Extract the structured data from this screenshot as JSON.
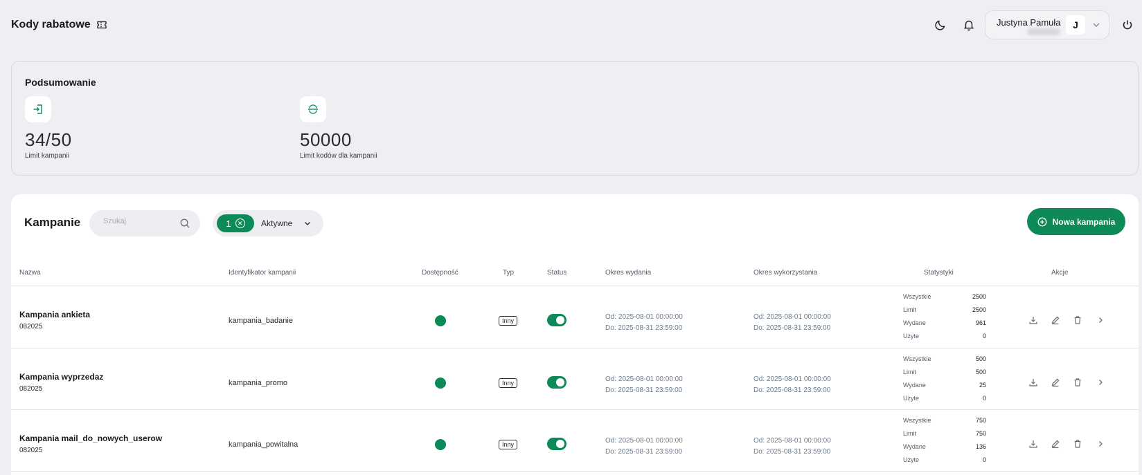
{
  "header": {
    "title": "Kody rabatowe",
    "user": {
      "name": "Justyna Pamuła",
      "avatar_letter": "J"
    }
  },
  "summary": {
    "title": "Podsumowanie",
    "stats": [
      {
        "value": "34/50",
        "label": "Limit kampanii",
        "icon": "login-arrow-icon"
      },
      {
        "value": "50000",
        "label": "Limit kodów dla kampanii",
        "icon": "code-limit-icon"
      }
    ]
  },
  "campaigns": {
    "title": "Kampanie",
    "search_placeholder": "Szukaj",
    "filter": {
      "count": "1",
      "label": "Aktywne"
    },
    "new_button": "Nowa kampania",
    "columns": [
      "Nazwa",
      "Identyfikator kampanii",
      "Dostępność",
      "Typ",
      "Status",
      "Okres wydania",
      "Okres wykorzystania",
      "Statystyki",
      "Akcje"
    ],
    "stat_keys": [
      "Wszystkie",
      "Limit",
      "Wydane",
      "Użyte"
    ],
    "rows": [
      {
        "name": "Kampania ankieta",
        "code": "082025",
        "identifier": "kampania_badanie",
        "type": "Inny",
        "issue_from": "Od: 2025-08-01 00:00:00",
        "issue_to": "Do: 2025-08-31 23:59:00",
        "use_from": "Od: 2025-08-01 00:00:00",
        "use_to": "Do: 2025-08-31 23:59:00",
        "stats": [
          "2500",
          "2500",
          "961",
          "0"
        ]
      },
      {
        "name": "Kampania wyprzedaz",
        "code": "082025",
        "identifier": "kampania_promo",
        "type": "Inny",
        "issue_from": "Od: 2025-08-01 00:00:00",
        "issue_to": "Do: 2025-08-31 23:59:00",
        "use_from": "Od: 2025-08-01 00:00:00",
        "use_to": "Do: 2025-08-31 23:59:00",
        "stats": [
          "500",
          "500",
          "25",
          "0"
        ]
      },
      {
        "name": "Kampania mail_do_nowych_userow",
        "code": "082025",
        "identifier": "kampania_powitalna",
        "type": "Inny",
        "issue_from": "Od: 2025-08-01 00:00:00",
        "issue_to": "Do: 2025-08-31 23:59:00",
        "use_from": "Od: 2025-08-01 00:00:00",
        "use_to": "Do: 2025-08-31 23:59:00",
        "stats": [
          "750",
          "750",
          "136",
          "0"
        ]
      }
    ]
  },
  "colors": {
    "accent": "#0d8a57",
    "background": "#efeff3"
  }
}
